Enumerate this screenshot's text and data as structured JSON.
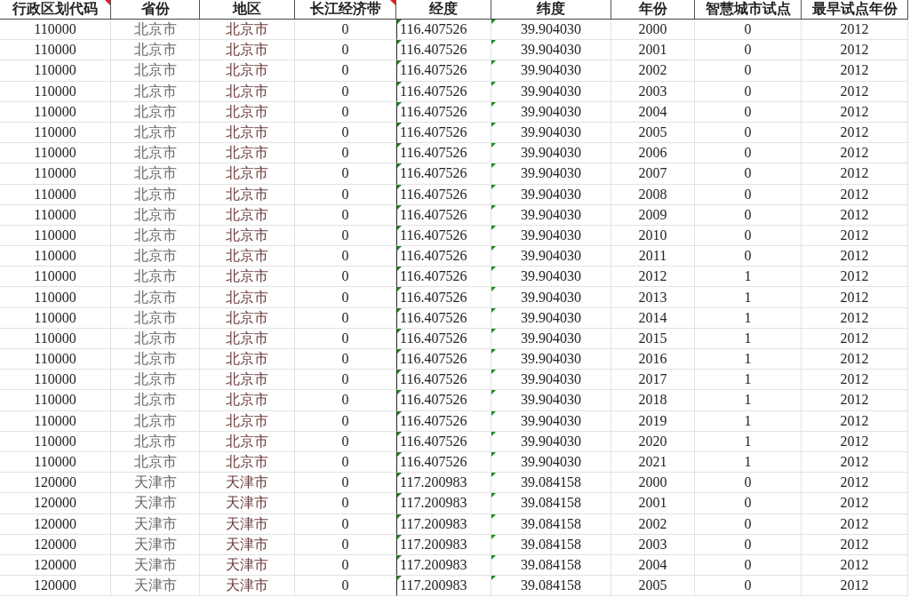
{
  "table": {
    "columns": [
      {
        "label": "行政区划代码",
        "comment": true,
        "number_as_text": false
      },
      {
        "label": "省份",
        "comment": false,
        "number_as_text": false
      },
      {
        "label": "地区",
        "comment": false,
        "number_as_text": false
      },
      {
        "label": "长江经济带",
        "comment": true,
        "number_as_text": false
      },
      {
        "label": "经度",
        "comment": false,
        "number_as_text": true
      },
      {
        "label": "纬度",
        "comment": false,
        "number_as_text": true
      },
      {
        "label": "年份",
        "comment": false,
        "number_as_text": false
      },
      {
        "label": "智慧城市试点",
        "comment": false,
        "number_as_text": false
      },
      {
        "label": "最早试点年份",
        "comment": false,
        "number_as_text": false
      }
    ],
    "rows": [
      [
        "110000",
        "北京市",
        "北京市",
        "0",
        "116.407526",
        "39.904030",
        "2000",
        "0",
        "2012"
      ],
      [
        "110000",
        "北京市",
        "北京市",
        "0",
        "116.407526",
        "39.904030",
        "2001",
        "0",
        "2012"
      ],
      [
        "110000",
        "北京市",
        "北京市",
        "0",
        "116.407526",
        "39.904030",
        "2002",
        "0",
        "2012"
      ],
      [
        "110000",
        "北京市",
        "北京市",
        "0",
        "116.407526",
        "39.904030",
        "2003",
        "0",
        "2012"
      ],
      [
        "110000",
        "北京市",
        "北京市",
        "0",
        "116.407526",
        "39.904030",
        "2004",
        "0",
        "2012"
      ],
      [
        "110000",
        "北京市",
        "北京市",
        "0",
        "116.407526",
        "39.904030",
        "2005",
        "0",
        "2012"
      ],
      [
        "110000",
        "北京市",
        "北京市",
        "0",
        "116.407526",
        "39.904030",
        "2006",
        "0",
        "2012"
      ],
      [
        "110000",
        "北京市",
        "北京市",
        "0",
        "116.407526",
        "39.904030",
        "2007",
        "0",
        "2012"
      ],
      [
        "110000",
        "北京市",
        "北京市",
        "0",
        "116.407526",
        "39.904030",
        "2008",
        "0",
        "2012"
      ],
      [
        "110000",
        "北京市",
        "北京市",
        "0",
        "116.407526",
        "39.904030",
        "2009",
        "0",
        "2012"
      ],
      [
        "110000",
        "北京市",
        "北京市",
        "0",
        "116.407526",
        "39.904030",
        "2010",
        "0",
        "2012"
      ],
      [
        "110000",
        "北京市",
        "北京市",
        "0",
        "116.407526",
        "39.904030",
        "2011",
        "0",
        "2012"
      ],
      [
        "110000",
        "北京市",
        "北京市",
        "0",
        "116.407526",
        "39.904030",
        "2012",
        "1",
        "2012"
      ],
      [
        "110000",
        "北京市",
        "北京市",
        "0",
        "116.407526",
        "39.904030",
        "2013",
        "1",
        "2012"
      ],
      [
        "110000",
        "北京市",
        "北京市",
        "0",
        "116.407526",
        "39.904030",
        "2014",
        "1",
        "2012"
      ],
      [
        "110000",
        "北京市",
        "北京市",
        "0",
        "116.407526",
        "39.904030",
        "2015",
        "1",
        "2012"
      ],
      [
        "110000",
        "北京市",
        "北京市",
        "0",
        "116.407526",
        "39.904030",
        "2016",
        "1",
        "2012"
      ],
      [
        "110000",
        "北京市",
        "北京市",
        "0",
        "116.407526",
        "39.904030",
        "2017",
        "1",
        "2012"
      ],
      [
        "110000",
        "北京市",
        "北京市",
        "0",
        "116.407526",
        "39.904030",
        "2018",
        "1",
        "2012"
      ],
      [
        "110000",
        "北京市",
        "北京市",
        "0",
        "116.407526",
        "39.904030",
        "2019",
        "1",
        "2012"
      ],
      [
        "110000",
        "北京市",
        "北京市",
        "0",
        "116.407526",
        "39.904030",
        "2020",
        "1",
        "2012"
      ],
      [
        "110000",
        "北京市",
        "北京市",
        "0",
        "116.407526",
        "39.904030",
        "2021",
        "1",
        "2012"
      ],
      [
        "120000",
        "天津市",
        "天津市",
        "0",
        "117.200983",
        "39.084158",
        "2000",
        "0",
        "2012"
      ],
      [
        "120000",
        "天津市",
        "天津市",
        "0",
        "117.200983",
        "39.084158",
        "2001",
        "0",
        "2012"
      ],
      [
        "120000",
        "天津市",
        "天津市",
        "0",
        "117.200983",
        "39.084158",
        "2002",
        "0",
        "2012"
      ],
      [
        "120000",
        "天津市",
        "天津市",
        "0",
        "117.200983",
        "39.084158",
        "2003",
        "0",
        "2012"
      ],
      [
        "120000",
        "天津市",
        "天津市",
        "0",
        "117.200983",
        "39.084158",
        "2004",
        "0",
        "2012"
      ],
      [
        "120000",
        "天津市",
        "天津市",
        "0",
        "117.200983",
        "39.084158",
        "2005",
        "0",
        "2012"
      ]
    ]
  }
}
